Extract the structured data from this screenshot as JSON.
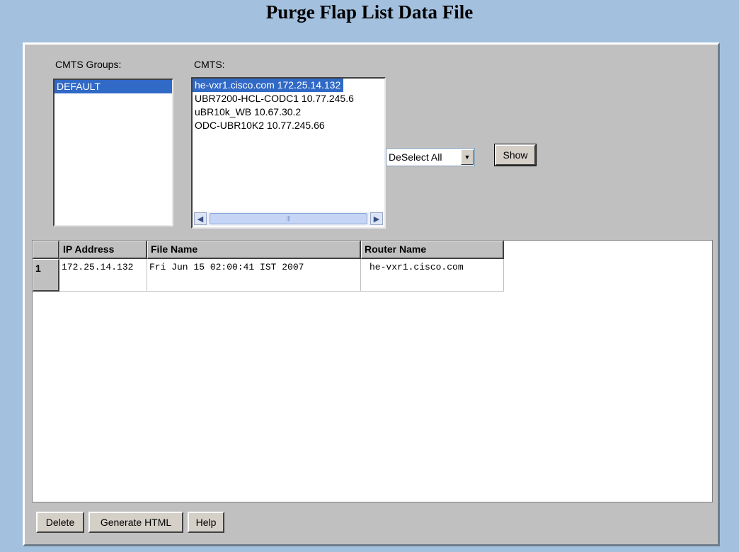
{
  "page": {
    "title": "Purge Flap List Data File"
  },
  "cmts_groups": {
    "label": "CMTS Groups:",
    "items": [
      "DEFAULT"
    ],
    "selected": "DEFAULT"
  },
  "cmts": {
    "label": "CMTS:",
    "items": [
      "he-vxr1.cisco.com 172.25.14.132",
      "UBR7200-HCL-CODC1 10.77.245.6",
      "uBR10k_WB 10.67.30.2",
      "ODC-UBR10K2 10.77.245.66"
    ],
    "selected": "he-vxr1.cisco.com 172.25.14.132"
  },
  "selection_dropdown": {
    "value": "DeSelect All"
  },
  "show_button": {
    "label": "Show"
  },
  "table": {
    "columns": [
      "",
      "IP Address",
      "File Name",
      "Router Name"
    ],
    "rows": [
      {
        "index": "1",
        "ip_address": "172.25.14.132",
        "file_name": "Fri Jun 15 02:00:41 IST 2007",
        "router_name": "he-vxr1.cisco.com"
      }
    ]
  },
  "footer_buttons": {
    "delete": "Delete",
    "generate_html": "Generate HTML",
    "help": "Help"
  },
  "colors": {
    "background": "#a3c0de",
    "panel": "#c0c0c0",
    "selection": "#3169c6"
  }
}
